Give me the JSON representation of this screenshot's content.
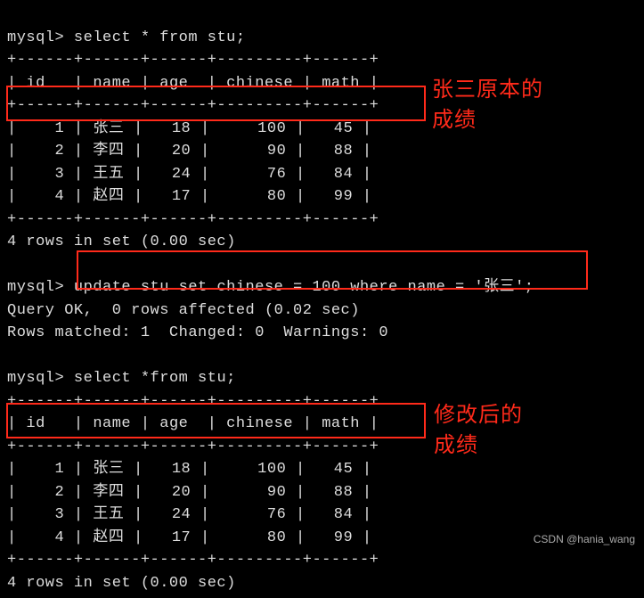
{
  "prompt": "mysql>",
  "queries": {
    "select1": "select * from stu;",
    "update": "update stu set chinese = 100 where name = '张三';",
    "select2": "select *from stu;"
  },
  "responses": {
    "query_ok": "Query OK,  0 rows affected (0.02 sec)",
    "rows_matched": "Rows matched: 1  Changed: 0  Warnings: 0",
    "rows_in_set": "4 rows in set (0.00 sec)"
  },
  "table_headers": {
    "id": "id",
    "name": "name",
    "age": "age",
    "chinese": "chinese",
    "math": "math"
  },
  "table_rows": [
    {
      "id": "1",
      "name": "张三",
      "age": "18",
      "chinese": "100",
      "math": "45"
    },
    {
      "id": "2",
      "name": "李四",
      "age": "20",
      "chinese": "90",
      "math": "88"
    },
    {
      "id": "3",
      "name": "王五",
      "age": "24",
      "chinese": "76",
      "math": "84"
    },
    {
      "id": "4",
      "name": "赵四",
      "age": "17",
      "chinese": "80",
      "math": "99"
    }
  ],
  "annotations": {
    "before_line1": "张三原本的",
    "before_line2": "成绩",
    "after_line1": "修改后的",
    "after_line2": "成绩"
  },
  "watermark": "CSDN @hania_wang"
}
